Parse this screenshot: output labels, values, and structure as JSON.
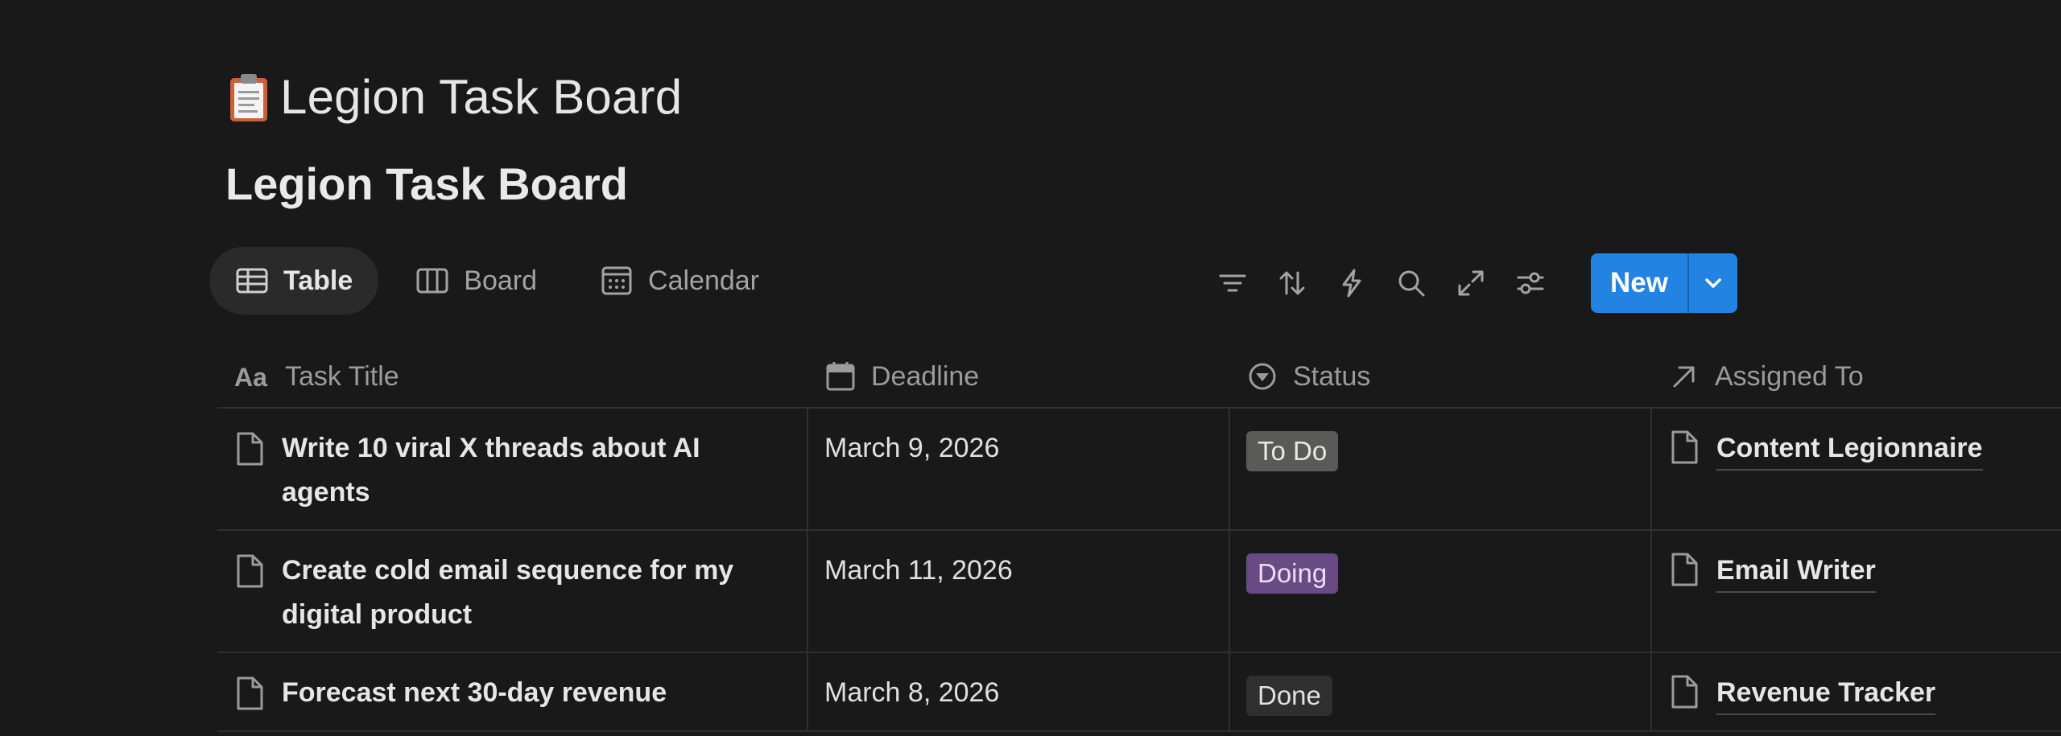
{
  "page": {
    "icon": "clipboard-icon",
    "title": "Legion Task Board"
  },
  "database": {
    "title": "Legion Task Board"
  },
  "views": [
    {
      "label": "Table",
      "icon": "table-icon",
      "active": true
    },
    {
      "label": "Board",
      "icon": "board-icon",
      "active": false
    },
    {
      "label": "Calendar",
      "icon": "calendar-icon",
      "active": false
    }
  ],
  "toolbar": {
    "icons": [
      "filter-icon",
      "sort-icon",
      "automation-icon",
      "search-icon",
      "expand-icon",
      "settings-icon"
    ],
    "new_label": "New",
    "accent": "#2383e2"
  },
  "table": {
    "columns": [
      {
        "label": "Task Title",
        "icon": "text-property-icon"
      },
      {
        "label": "Deadline",
        "icon": "date-property-icon"
      },
      {
        "label": "Status",
        "icon": "status-property-icon"
      },
      {
        "label": "Assigned To",
        "icon": "relation-property-icon"
      }
    ],
    "rows": [
      {
        "title": "Write 10 viral X threads about AI agents",
        "deadline": "March 9, 2026",
        "status": {
          "label": "To Do",
          "bg": "#5a5a58",
          "fg": "#e8e8e8"
        },
        "assigned": "Content Legionnaire"
      },
      {
        "title": "Create cold email sequence for my digital product",
        "deadline": "March 11, 2026",
        "status": {
          "label": "Doing",
          "bg": "#6a4a85",
          "fg": "#ecdcf6"
        },
        "assigned": "Email Writer"
      },
      {
        "title": "Forecast next 30-day revenue",
        "deadline": "March 8, 2026",
        "status": {
          "label": "Done",
          "bg": "#2f2f2f",
          "fg": "#e0e0e0"
        },
        "assigned": "Revenue Tracker"
      }
    ]
  }
}
